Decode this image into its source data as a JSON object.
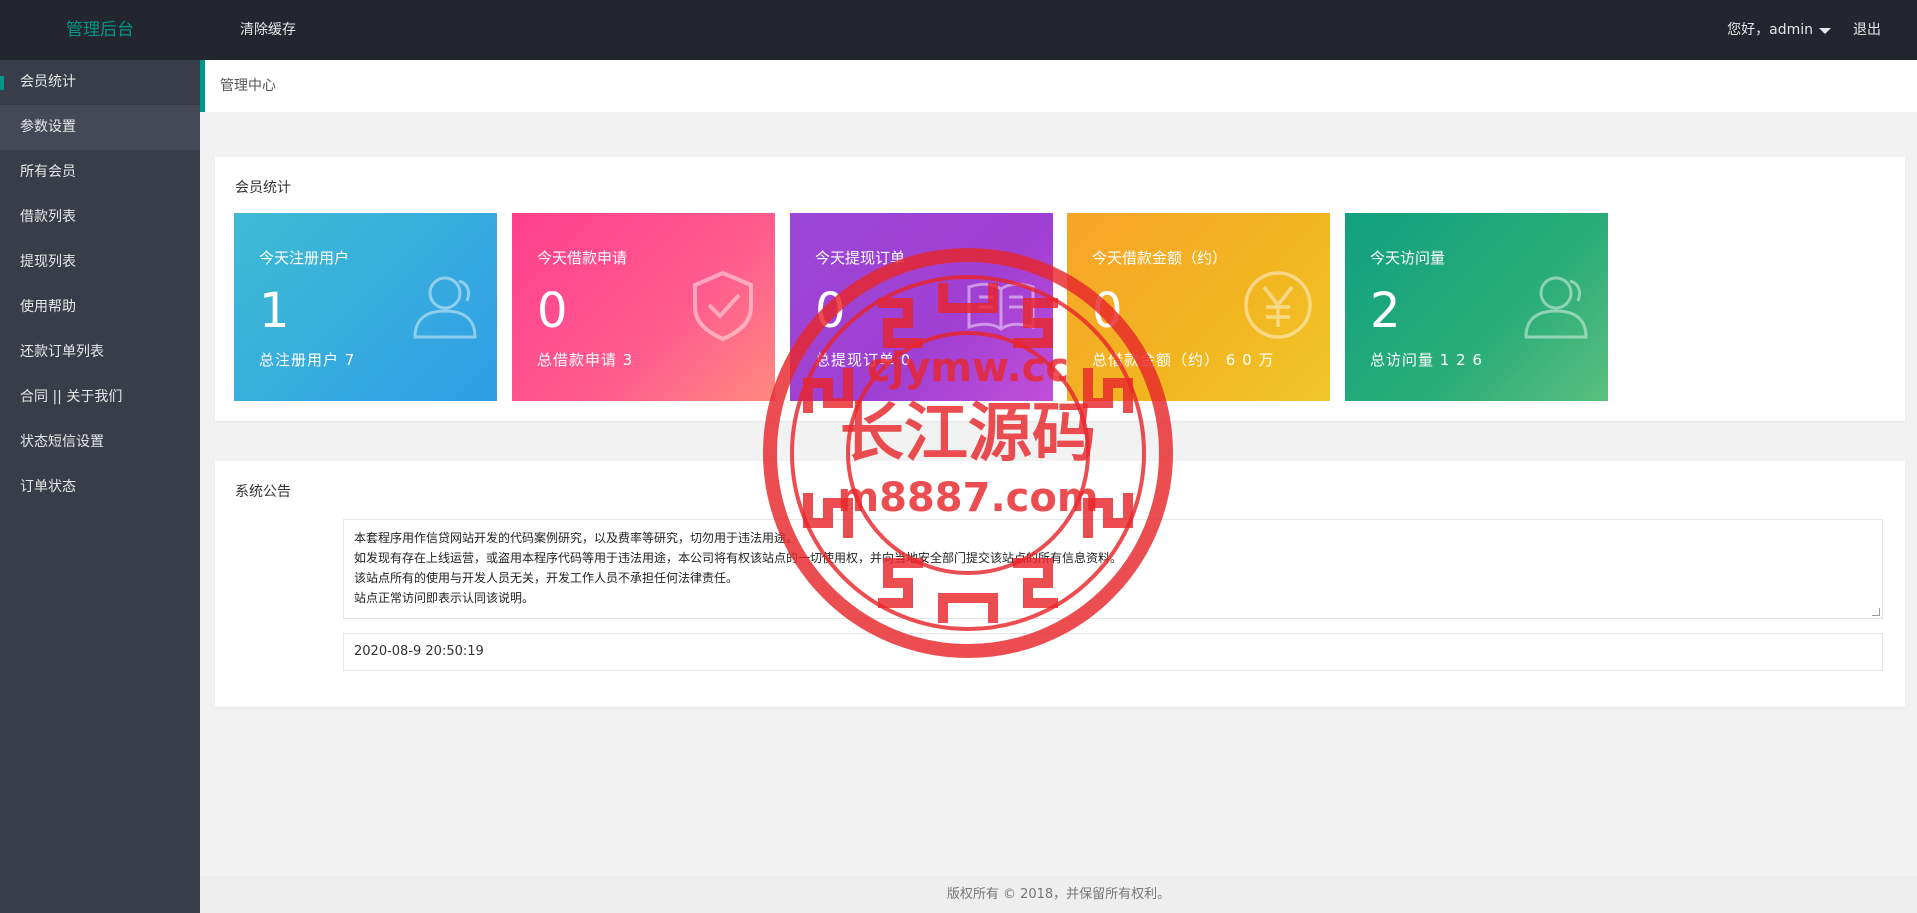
{
  "header": {
    "logo": "管理后台",
    "clear_cache": "清除缓存",
    "greeting": "您好，admin",
    "logout": "退出"
  },
  "sidebar": {
    "items": [
      {
        "label": "会员统计"
      },
      {
        "label": "参数设置"
      },
      {
        "label": "所有会员"
      },
      {
        "label": "借款列表"
      },
      {
        "label": "提现列表"
      },
      {
        "label": "使用帮助"
      },
      {
        "label": "还款订单列表"
      },
      {
        "label": "合同 || 关于我们"
      },
      {
        "label": "状态短信设置"
      },
      {
        "label": "订单状态"
      }
    ]
  },
  "breadcrumb": "管理中心",
  "stats_section": {
    "title": "会员统计",
    "cards": [
      {
        "label": "今天注册用户",
        "value": "1",
        "total": "总注册用户 7",
        "icon": "user-icon",
        "color": "#2f9ee6"
      },
      {
        "label": "今天借款申请",
        "value": "0",
        "total": "总借款申请 3",
        "icon": "shield-check-icon",
        "color": "#ff5c8e"
      },
      {
        "label": "今天提现订单",
        "value": "0",
        "total": "总提现订单 0",
        "icon": "book-icon",
        "color": "#a03fd3"
      },
      {
        "label": "今天借款金额（约）",
        "value": "0",
        "total": "总借款金额（约） 6 0 万",
        "icon": "yen-icon",
        "color": "#f2b620"
      },
      {
        "label": "今天访问量",
        "value": "2",
        "total": "总访问量 1 2 6",
        "icon": "user-icon",
        "color": "#2aad78"
      }
    ]
  },
  "notice_section": {
    "title": "系统公告",
    "lines": [
      "本套程序用作信贷网站开发的代码案例研究，以及费率等研究，切勿用于违法用途。",
      "如发现有存在上线运营，或盗用本程序代码等用于违法用途，本公司将有权该站点的一切使用权，并向当地安全部门提交该站点的所有信息资料。",
      "该站点所有的使用与开发人员无关，开发工作人员不承担任何法律责任。",
      "站点正常访问即表示认同该说明。"
    ],
    "date": "2020-08-9 20:50:19"
  },
  "footer": "版权所有 © 2018，并保留所有权利。",
  "watermark": {
    "url": "cjymw.cc",
    "name": "长江源码",
    "domain": "m8887.com"
  }
}
